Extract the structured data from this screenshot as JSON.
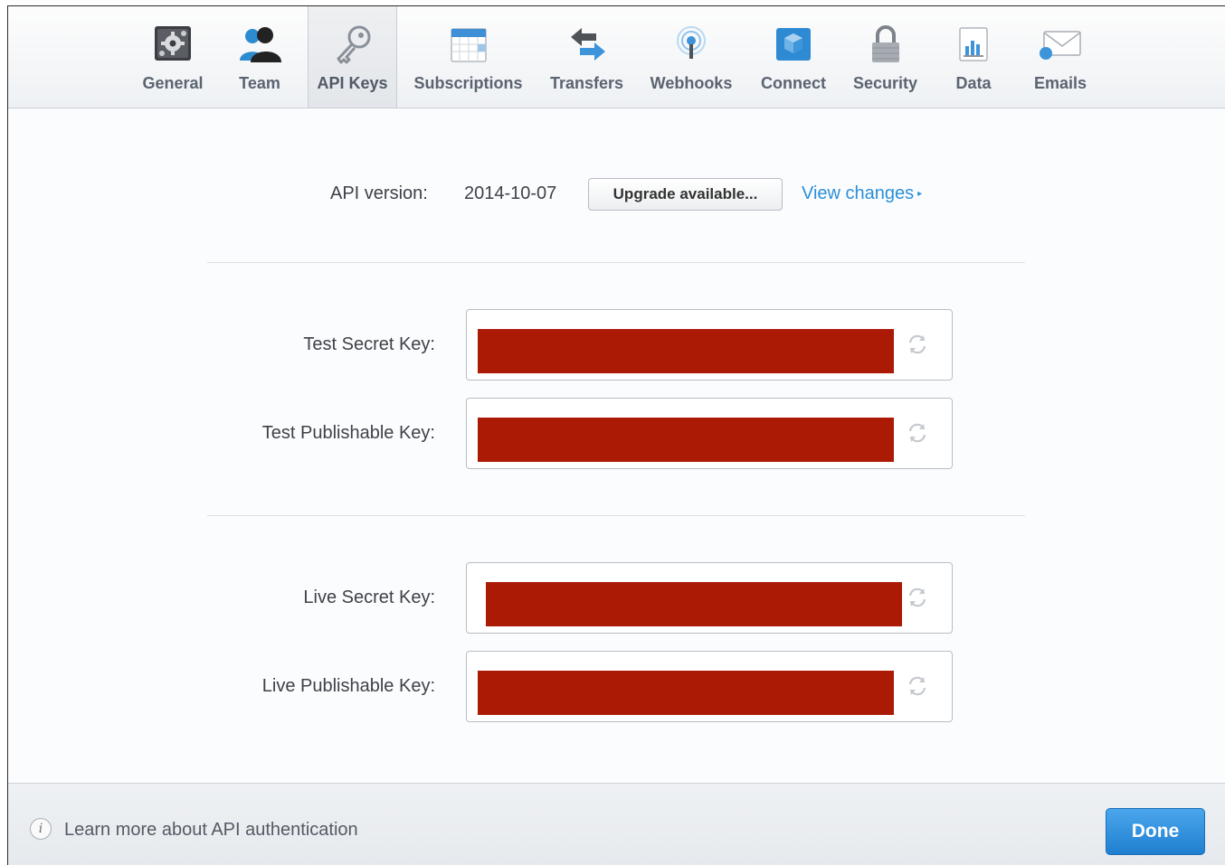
{
  "tabs": [
    {
      "label": "General",
      "icon": "gear-icon",
      "active": false
    },
    {
      "label": "Team",
      "icon": "team-icon",
      "active": false
    },
    {
      "label": "API Keys",
      "icon": "key-icon",
      "active": true
    },
    {
      "label": "Subscriptions",
      "icon": "calendar-icon",
      "active": false
    },
    {
      "label": "Transfers",
      "icon": "transfer-arrows-icon",
      "active": false
    },
    {
      "label": "Webhooks",
      "icon": "broadcast-icon",
      "active": false
    },
    {
      "label": "Connect",
      "icon": "cube-icon",
      "active": false
    },
    {
      "label": "Security",
      "icon": "lock-icon",
      "active": false
    },
    {
      "label": "Data",
      "icon": "bar-chart-document-icon",
      "active": false
    },
    {
      "label": "Emails",
      "icon": "envelope-icon",
      "active": false
    }
  ],
  "api": {
    "label": "API version:",
    "version": "2014-10-07",
    "upgrade_label": "Upgrade available...",
    "view_changes_label": "View changes",
    "caret": "▸"
  },
  "keys": {
    "test_secret_label": "Test Secret Key:",
    "test_publishable_label": "Test Publishable Key:",
    "live_secret_label": "Live Secret Key:",
    "live_publishable_label": "Live Publishable Key:",
    "redaction_color": "#ab1a05"
  },
  "footer": {
    "info_glyph": "i",
    "learn_more_label": "Learn more about API authentication",
    "done_label": "Done"
  },
  "colors": {
    "link": "#2b8fd6",
    "done_button": "#2a88d8"
  }
}
